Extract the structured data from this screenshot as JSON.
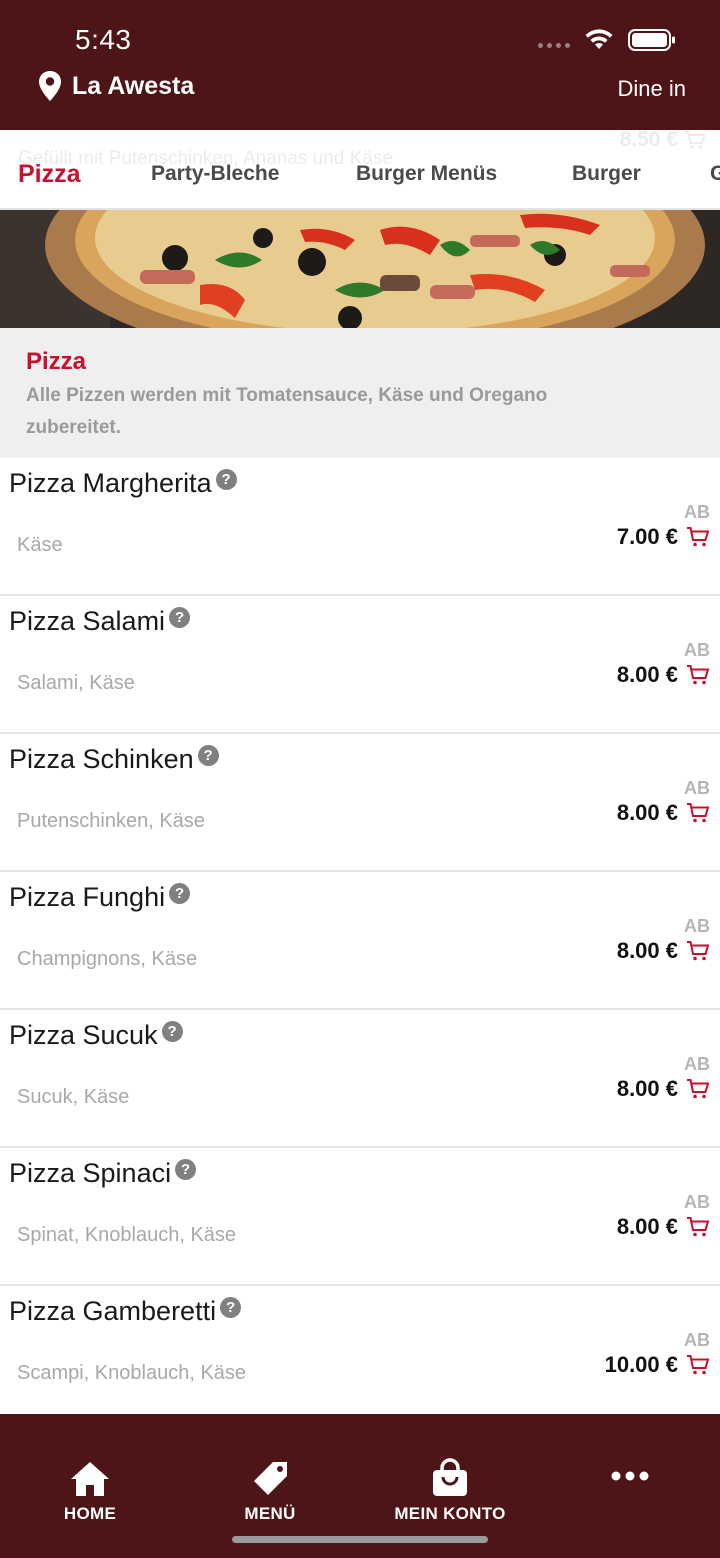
{
  "status_bar": {
    "time": "5:43"
  },
  "header": {
    "location": "La Awesta",
    "mode": "Dine in"
  },
  "ghost_row": {
    "text": "Gefüllt mit Putenschinken, Ananas und Käse",
    "price": "8.50 €"
  },
  "tabs": [
    {
      "label": "Pizza",
      "active": true
    },
    {
      "label": "Party-Bleche",
      "active": false
    },
    {
      "label": "Burger Menüs",
      "active": false
    },
    {
      "label": "Burger",
      "active": false
    },
    {
      "label": "G",
      "active": false
    }
  ],
  "category": {
    "title": "Pizza",
    "description": "Alle Pizzen werden mit Tomatensauce, Käse und Oregano zubereitet."
  },
  "items": [
    {
      "name": "Pizza Margherita",
      "description": "Käse",
      "ab": "AB",
      "price": "7.00 €"
    },
    {
      "name": "Pizza Salami",
      "description": "Salami, Käse",
      "ab": "AB",
      "price": "8.00 €"
    },
    {
      "name": "Pizza Schinken",
      "description": "Putenschinken, Käse",
      "ab": "AB",
      "price": "8.00 €"
    },
    {
      "name": "Pizza Funghi",
      "description": "Champignons, Käse",
      "ab": "AB",
      "price": "8.00 €"
    },
    {
      "name": "Pizza Sucuk",
      "description": "Sucuk, Käse",
      "ab": "AB",
      "price": "8.00 €"
    },
    {
      "name": "Pizza Spinaci",
      "description": "Spinat, Knoblauch, Käse",
      "ab": "AB",
      "price": "8.00 €"
    },
    {
      "name": "Pizza Gamberetti",
      "description": "Scampi, Knoblauch, Käse",
      "ab": "AB",
      "price": "10.00 €"
    }
  ],
  "help_glyph": "?",
  "bottom_nav": [
    {
      "label": "HOME",
      "icon": "home-icon"
    },
    {
      "label": "MENÜ",
      "icon": "tag-icon"
    },
    {
      "label": "MEIN KONTO",
      "icon": "shopping-bag-icon"
    },
    {
      "label": "",
      "icon": "more-icon"
    }
  ],
  "colors": {
    "header_bg": "#4e1519",
    "accent": "#c8102e",
    "text_muted": "#a8a8a8"
  }
}
